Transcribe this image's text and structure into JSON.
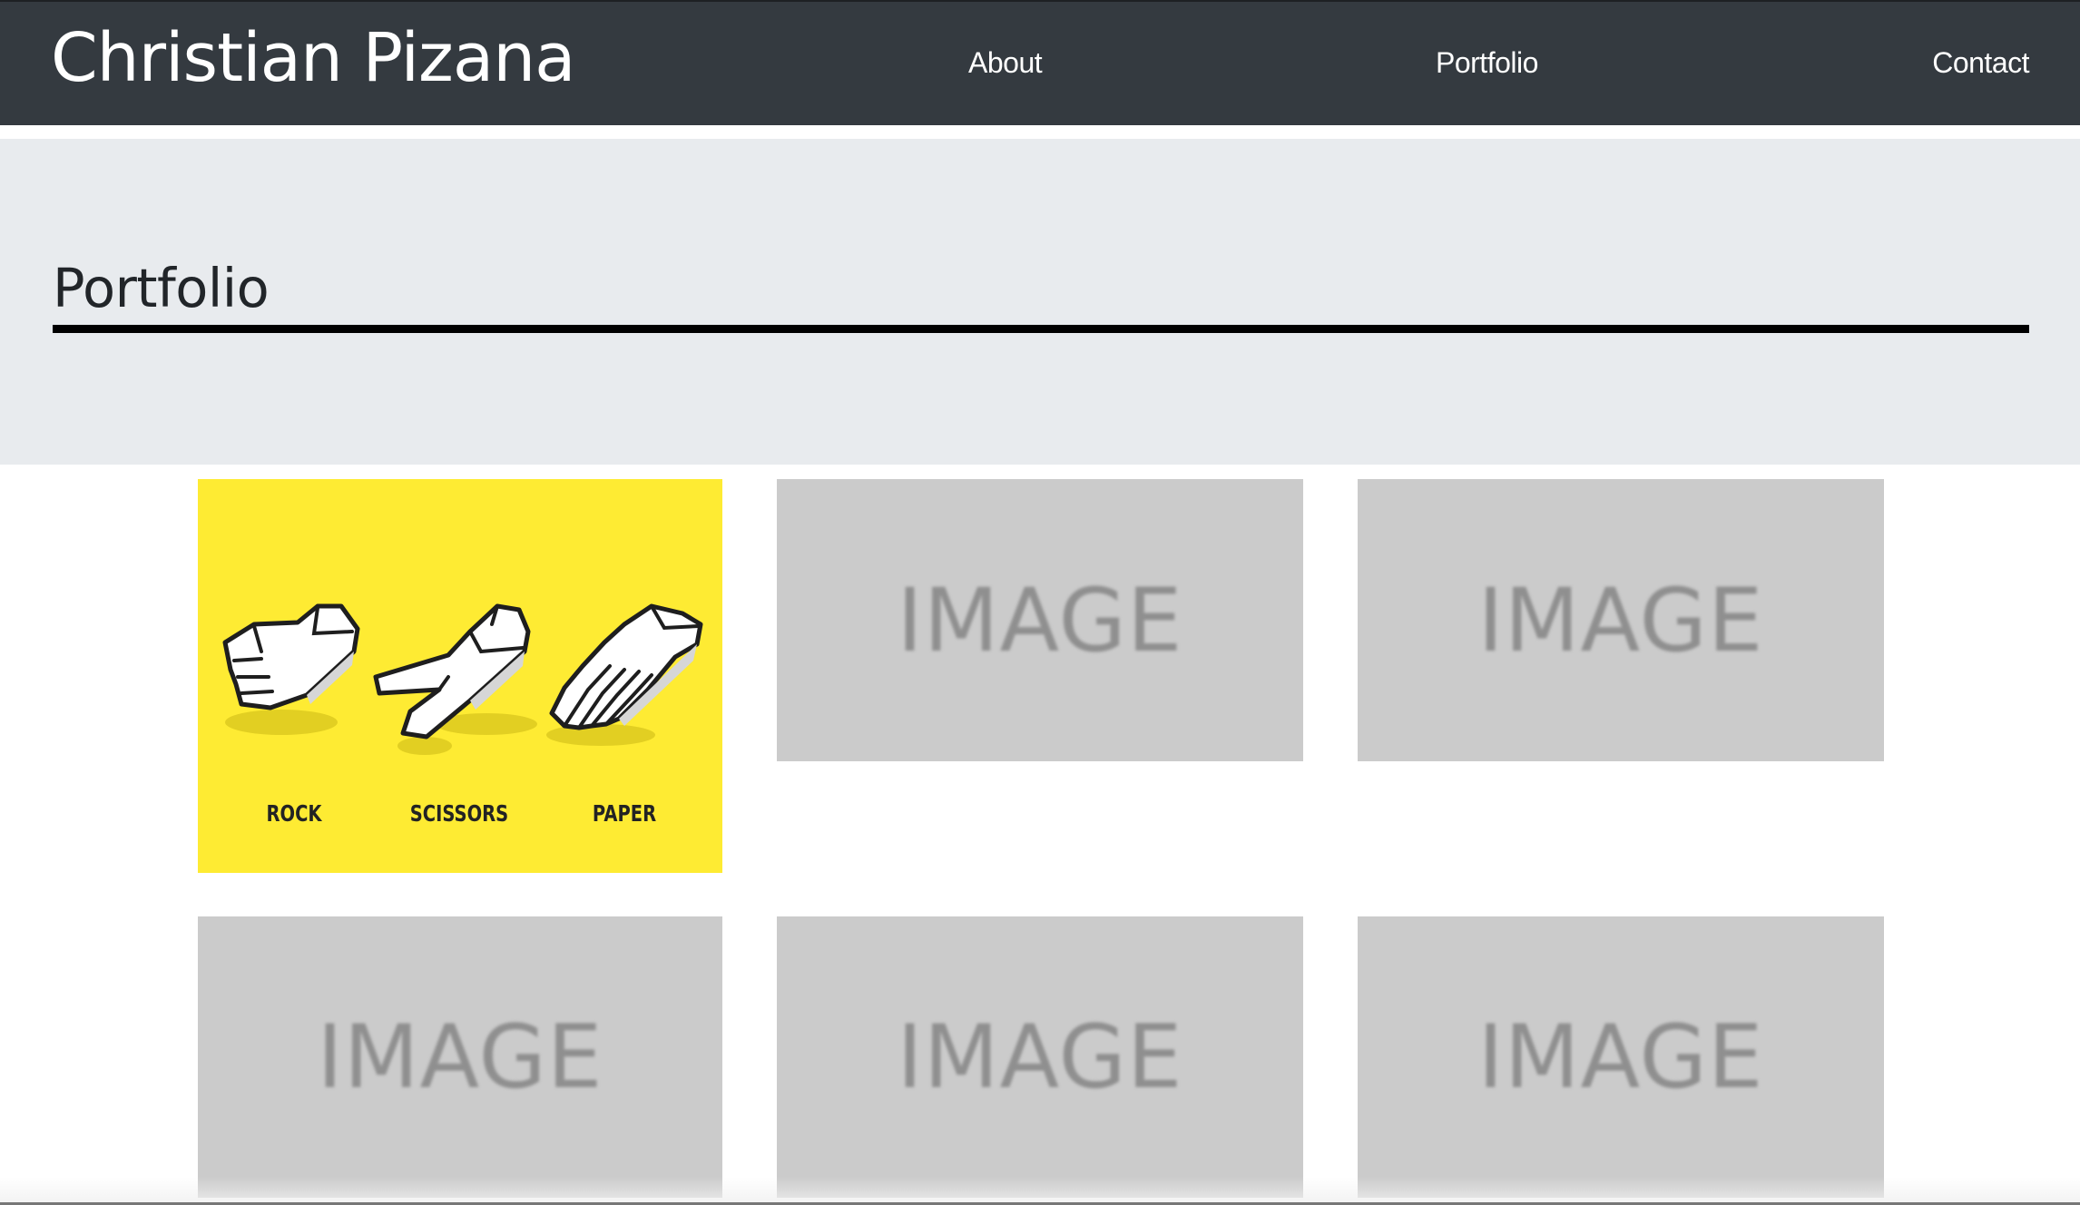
{
  "navbar": {
    "brand": "Christian Pizana",
    "links": [
      "About",
      "Portfolio",
      "Contact"
    ]
  },
  "jumbotron": {
    "title": "Portfolio"
  },
  "portfolio": {
    "featured": {
      "labels": [
        "ROCK",
        "SCISSORS",
        "PAPER"
      ],
      "background": "#feeb33"
    },
    "placeholder_text": [
      "IMAGE",
      "IMAGE",
      "IMAGE",
      "IMAGE",
      "IMAGE"
    ]
  },
  "colors": {
    "navbar": "#343a40",
    "jumbotron": "#e8ebee",
    "placeholder": "#cbcbcb",
    "placeholder_text": "#8f8f8f"
  }
}
